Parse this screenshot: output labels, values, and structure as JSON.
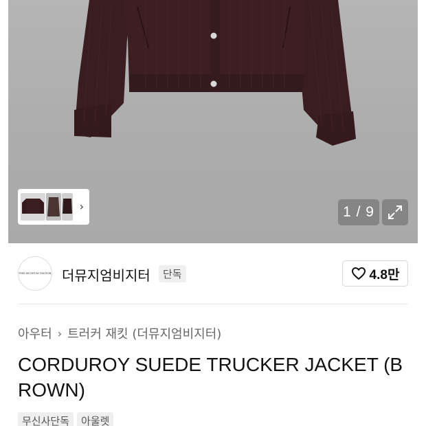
{
  "gallery": {
    "counter_text": "1 / 9",
    "thumb_arrow": "›",
    "colors": {
      "background": "#b0b0b0",
      "jacket": "#3b1e20"
    }
  },
  "brand": {
    "logo_text": "THE MUSEUM VISITOR",
    "name": "더뮤지엄비지터",
    "exclusive_badge": "단독"
  },
  "like": {
    "count": "4.8만",
    "icon": "heart-outline-icon"
  },
  "breadcrumb": {
    "category": "아우터",
    "separator": "›",
    "subcategory": "트러커 재킷 (더뮤지엄비지터)"
  },
  "product": {
    "title": "CORDUROY SUEDE TRUCKER JACKET (BROWN)"
  },
  "tags": [
    "무신사단독",
    "아울렛"
  ]
}
